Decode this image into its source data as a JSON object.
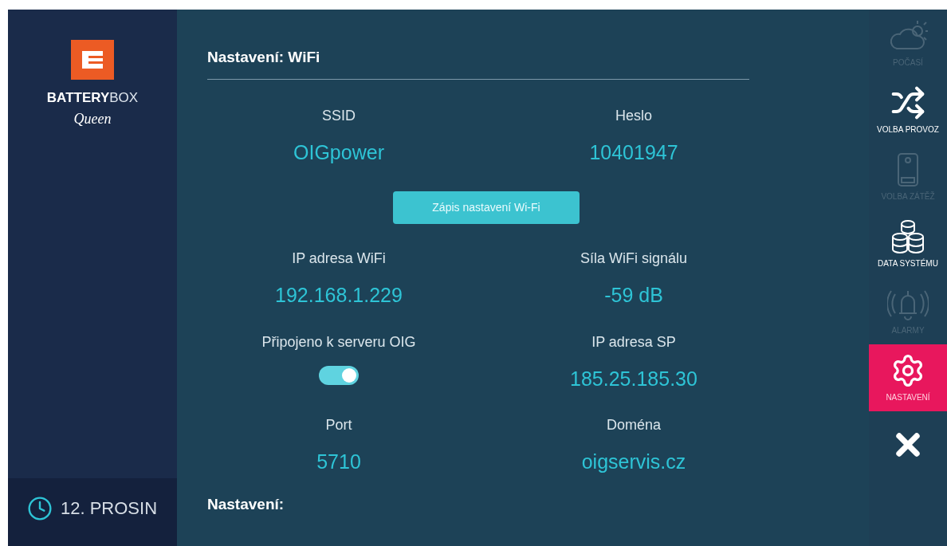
{
  "brand": {
    "name_bold": "BATTERY",
    "name_light": "BOX",
    "subtitle": "Queen"
  },
  "status_bar": {
    "date": "12. PROSIN"
  },
  "dialog": {
    "title": "Nastavení: WiFi",
    "items": [
      {
        "kind": "value",
        "label": "SSID",
        "value": "OIGpower"
      },
      {
        "kind": "value",
        "label": "Heslo",
        "value": "10401947"
      },
      {
        "kind": "button",
        "label": "Zápis nastavení Wi-Fi"
      },
      {
        "kind": "value",
        "label": "IP adresa WiFi",
        "value": "192.168.1.229"
      },
      {
        "kind": "value",
        "label": "Síla WiFi signálu",
        "value": "-59 dB"
      },
      {
        "kind": "toggle",
        "label": "Připojeno k serveru OIG",
        "on": true
      },
      {
        "kind": "value",
        "label": "IP adresa SP",
        "value": "185.25.185.30"
      },
      {
        "kind": "value",
        "label": "Port",
        "value": "5710"
      },
      {
        "kind": "value",
        "label": "Doména",
        "value": "oigservis.cz"
      }
    ],
    "next_section": "Nastavení:"
  },
  "sidebar": {
    "items": [
      {
        "label": "POČASÍ",
        "disabled": true,
        "selected": false
      },
      {
        "label": "VOLBA PROVOZ",
        "disabled": false,
        "selected": false
      },
      {
        "label": "VOLBA ZÁTĚŽ",
        "disabled": true,
        "selected": false
      },
      {
        "label": "DATA SYSTÉMU",
        "disabled": false,
        "selected": false
      },
      {
        "label": "ALARMY",
        "disabled": true,
        "selected": false
      },
      {
        "label": "NASTAVENÍ",
        "disabled": false,
        "selected": true
      },
      {
        "disabled": false,
        "selected": false
      }
    ]
  }
}
